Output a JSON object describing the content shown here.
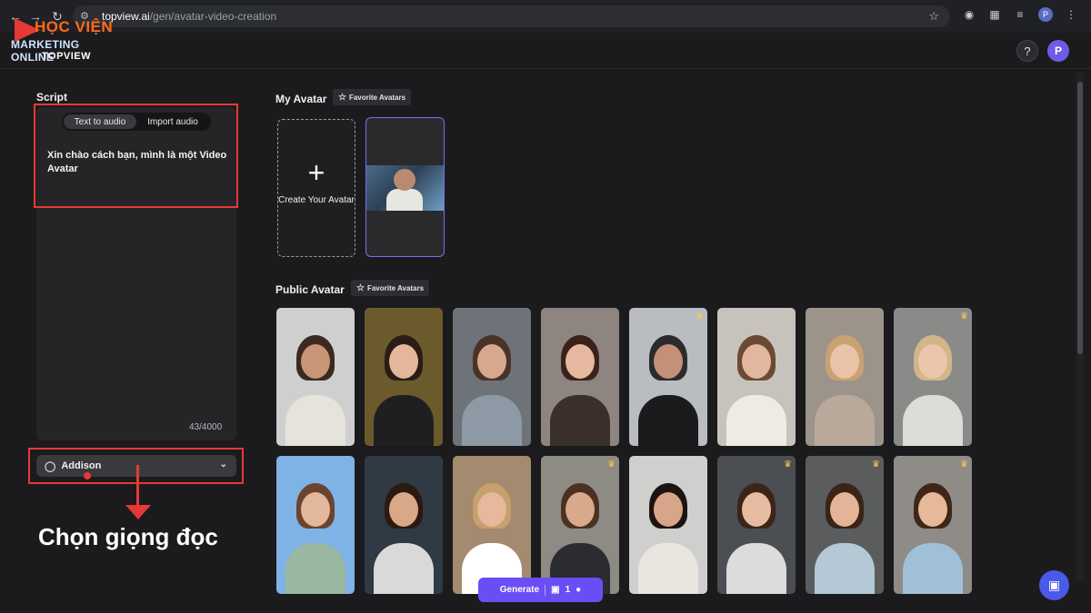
{
  "browser": {
    "url_host": "topview.ai",
    "url_path": "/gen/avatar-video-creation",
    "profile_initial": "P"
  },
  "watermark": {
    "line1": "HỌC VIỆN",
    "line2": "MARKETING ONLINE",
    "line3": "TOPVIEW"
  },
  "header": {
    "help_label": "?",
    "user_initial": "P"
  },
  "script": {
    "title": "Script",
    "tabs": [
      {
        "label": "Text to audio",
        "active": true
      },
      {
        "label": "Import audio",
        "active": false
      }
    ],
    "text": "Xin chào cách bạn, mình là một Video Avatar",
    "char_count": "43/4000"
  },
  "voice": {
    "selected": "Addison"
  },
  "annotation": {
    "caption": "Chọn giọng đọc"
  },
  "my_avatar": {
    "title": "My Avatar",
    "favorite_label": "Favorite Avatars",
    "create_label": "Create Your Avatar"
  },
  "public_avatar": {
    "title": "Public Avatar",
    "favorite_label": "Favorite Avatars",
    "tiles": [
      {
        "premium": false,
        "bg": "#cfcfd0",
        "skin": "#c99577",
        "hair": "#3b2a22",
        "cloth": "#e6e3dc"
      },
      {
        "premium": false,
        "bg": "#6b5a2c",
        "skin": "#e4b79a",
        "hair": "#2a1d16",
        "cloth": "#1f1f22"
      },
      {
        "premium": false,
        "bg": "#6d7378",
        "skin": "#d7a88d",
        "hair": "#4a3326",
        "cloth": "#8d9aa6"
      },
      {
        "premium": false,
        "bg": "#8e8480",
        "skin": "#e7b8a0",
        "hair": "#3a2219",
        "cloth": "#3b2f2c"
      },
      {
        "premium": true,
        "bg": "#b9bdc2",
        "skin": "#c49077",
        "hair": "#2b2b2e",
        "cloth": "#1b1b1d"
      },
      {
        "premium": false,
        "bg": "#c7c3bc",
        "skin": "#e2b79d",
        "hair": "#6b4a34",
        "cloth": "#efeae2"
      },
      {
        "premium": false,
        "bg": "#9c948b",
        "skin": "#eac3a8",
        "hair": "#c9a273",
        "cloth": "#b9a99a"
      },
      {
        "premium": true,
        "bg": "#8a8a88",
        "skin": "#ecc6ab",
        "hair": "#d3b58a",
        "cloth": "#dedcd8"
      },
      {
        "premium": false,
        "bg": "#7fb3e6",
        "skin": "#e3b79b",
        "hair": "#6b4430",
        "cloth": "#9ab7a0"
      },
      {
        "premium": false,
        "bg": "#2f3a45",
        "skin": "#d9a888",
        "hair": "#2a1a12",
        "cloth": "#d9d9d9"
      },
      {
        "premium": false,
        "bg": "#a48a6e",
        "skin": "#e6b99c",
        "hair": "#c8a06d",
        "cloth": "#ffffff"
      },
      {
        "premium": true,
        "bg": "#8e8a84",
        "skin": "#d9a98c",
        "hair": "#4a3122",
        "cloth": "#2a2c30"
      },
      {
        "premium": false,
        "bg": "#cfcfce",
        "skin": "#d9a58a",
        "hair": "#1d1411",
        "cloth": "#e9e6e0"
      },
      {
        "premium": true,
        "bg": "#4b4e52",
        "skin": "#e8bca2",
        "hair": "#3b2518",
        "cloth": "#dcdcdc"
      },
      {
        "premium": true,
        "bg": "#5a5c5e",
        "skin": "#e3b497",
        "hair": "#3a2416",
        "cloth": "#b5c8d6"
      },
      {
        "premium": true,
        "bg": "#8f8b86",
        "skin": "#e6b99a",
        "hair": "#3e2718",
        "cloth": "#9fc0d8"
      }
    ]
  },
  "footer": {
    "generate_label": "Generate",
    "credit_count": "1"
  }
}
